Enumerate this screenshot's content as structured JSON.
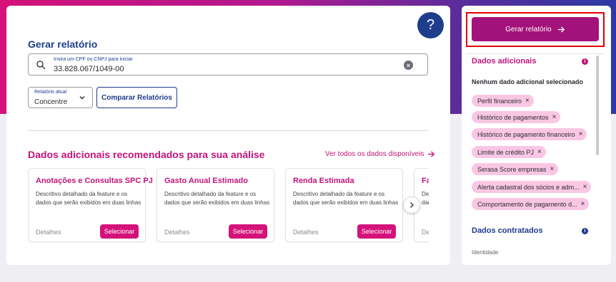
{
  "main": {
    "title": "Gerar relatório",
    "help_label": "?",
    "search": {
      "label": "Insira um CPF ou CNPJ para iniciar",
      "value": "33.828.067/1049-00"
    },
    "report_select": {
      "label": "Relatório atual",
      "value": "Concentre"
    },
    "compare_label": "Comparar Relatórios",
    "recommended": {
      "title": "Dados adicionais recomendados para sua análise",
      "view_all": "Ver todos os dados disponíveis",
      "cards": [
        {
          "title": "Anotações e Consultas SPC PJ",
          "desc": "Descritivo detalhado da feature e os dados que serão exibidos em duas linhas",
          "details": "Detalhes",
          "select": "Selecionar"
        },
        {
          "title": "Gasto Anual Estimado",
          "desc": "Descritivo detalhado da feature e os dados que serão exibidos em duas linhas",
          "details": "Detalhes",
          "select": "Selecionar"
        },
        {
          "title": "Renda Estimada",
          "desc": "Descritivo detalhado da feature e os dados que serão exibidos em duas linhas",
          "details": "Detalhes",
          "select": "Selecionar"
        },
        {
          "title": "Fa",
          "desc": "Des dad",
          "details": "De",
          "select": ""
        }
      ]
    }
  },
  "side": {
    "generate_label": "Gerar relatório",
    "additional_title": "Dados adicionais",
    "none_selected": "Nenhum dado adicional selecionado",
    "chips": [
      "Perfil financeiro",
      "Histórico de pagamentos",
      "Histórico de pagamento financeiro",
      "Limite de crédito PJ",
      "Serasa Score empresas",
      "Alerta cadastral dos sócios e adm...",
      "Comportamento de pagamento d..."
    ],
    "chip_remove": "×",
    "contracted_title": "Dados contratados",
    "identity_label": "Identidade"
  },
  "colors": {
    "brand_magenta": "#d4127a",
    "brand_blue": "#1e3d8c",
    "chip_bg": "#f9c7e3",
    "highlight_frame": "#e40000"
  }
}
